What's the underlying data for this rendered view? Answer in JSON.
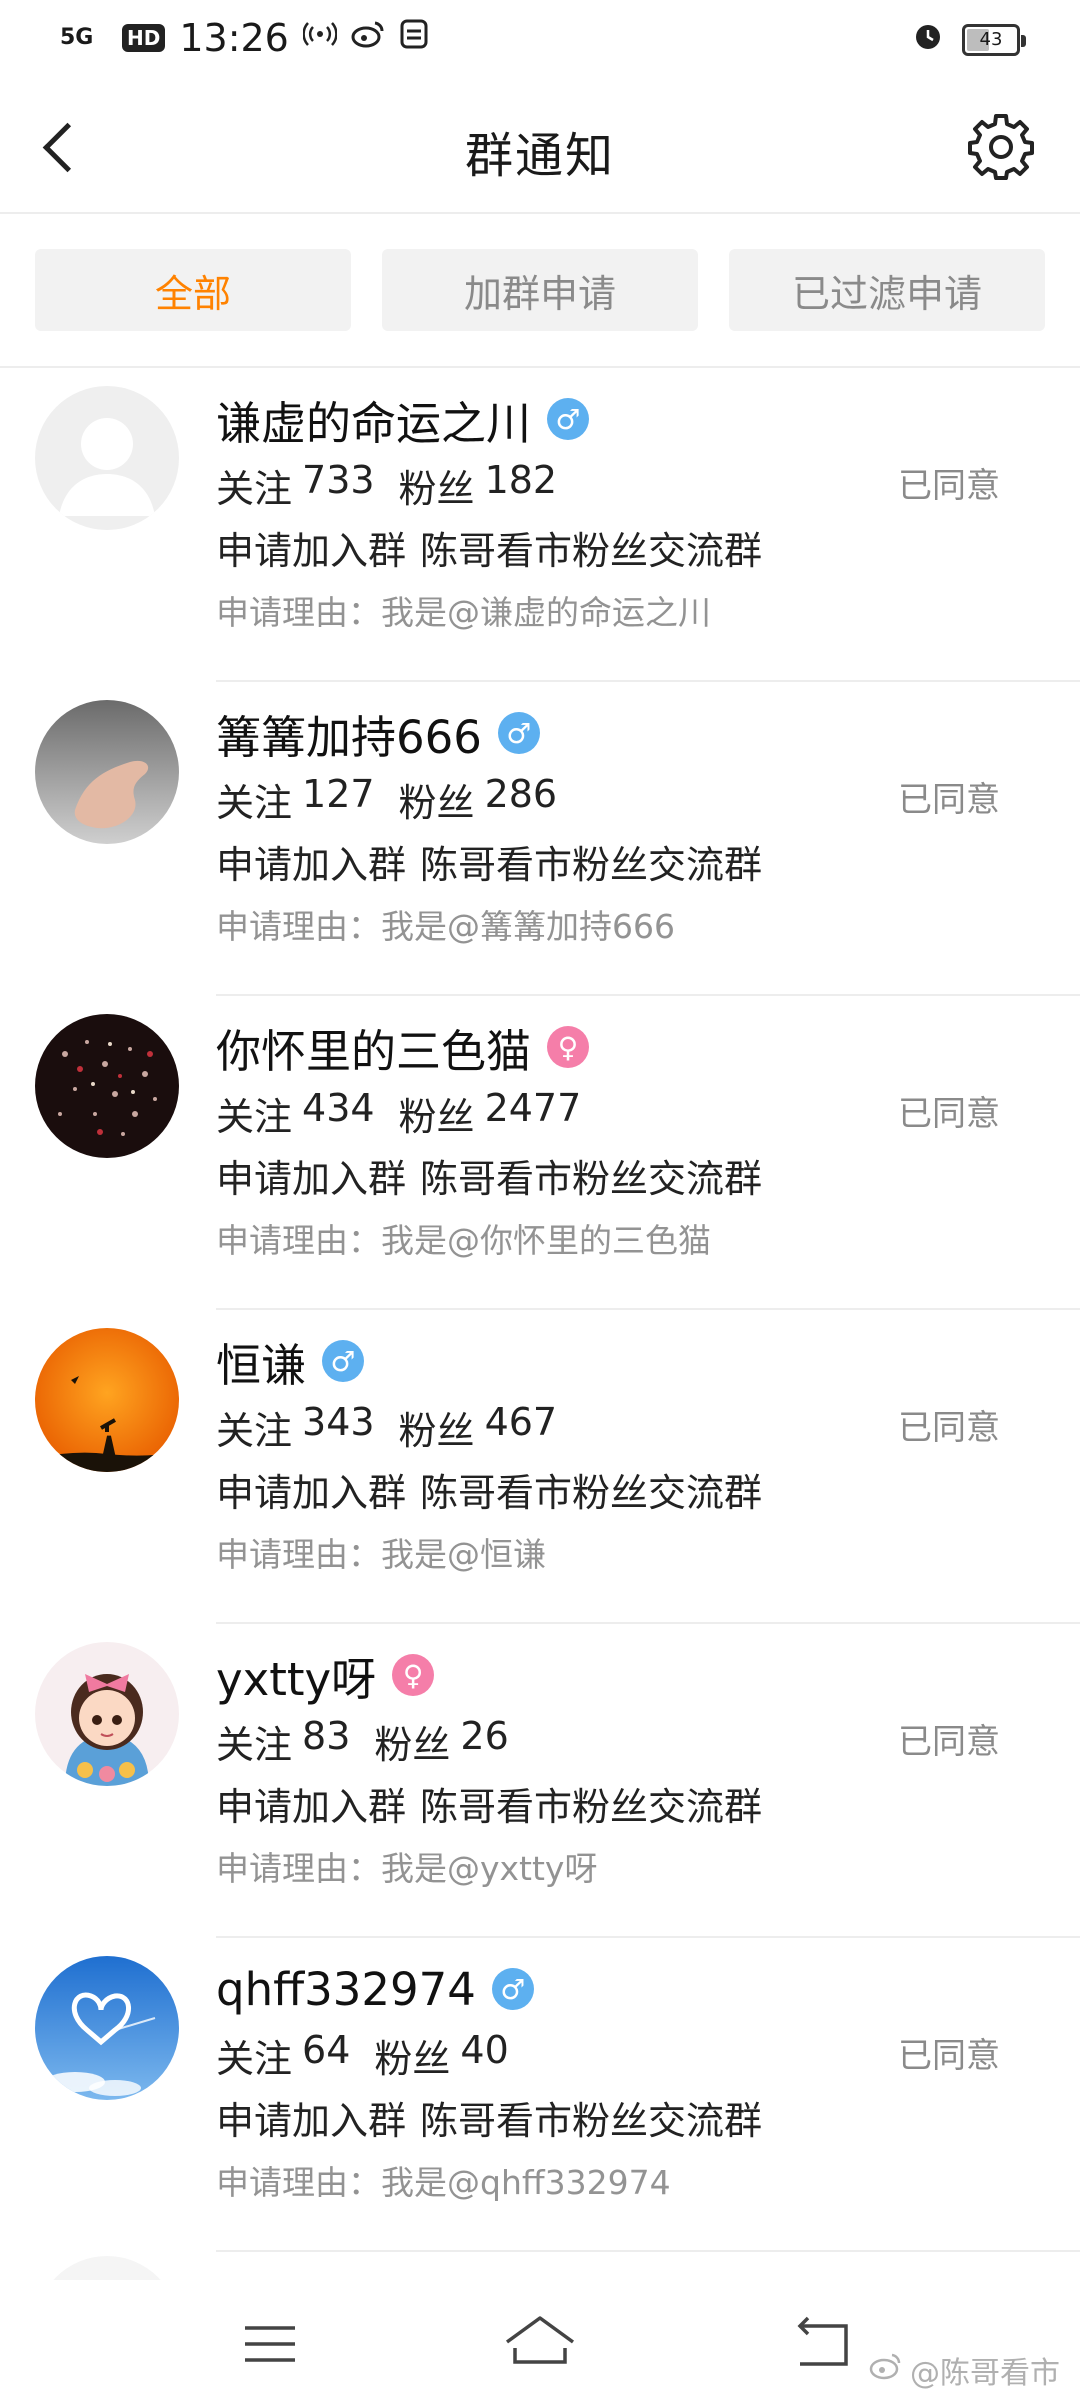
{
  "status_bar": {
    "network": "5G",
    "hd": "HD",
    "time": "13:26",
    "battery": "43",
    "battery_level": 0.43
  },
  "header": {
    "title": "群通知"
  },
  "tabs": [
    {
      "label": "全部",
      "active": true
    },
    {
      "label": "加群申请",
      "active": false
    },
    {
      "label": "已过滤申请",
      "active": false
    }
  ],
  "labels": {
    "follow": "关注",
    "fans": "粉丝",
    "apply_prefix": "申请加入群",
    "reason_prefix": "申请理由："
  },
  "requests": [
    {
      "name": "谦虚的命运之川",
      "gender": "male",
      "follow": "733",
      "fans": "182",
      "group": "陈哥看市粉丝交流群",
      "reason": "我是@谦虚的命运之川",
      "status": "已同意"
    },
    {
      "name": "篝篝加持666",
      "gender": "male",
      "follow": "127",
      "fans": "286",
      "group": "陈哥看市粉丝交流群",
      "reason": "我是@篝篝加持666",
      "status": "已同意"
    },
    {
      "name": "你怀里的三色猫",
      "gender": "female",
      "follow": "434",
      "fans": "2477",
      "group": "陈哥看市粉丝交流群",
      "reason": "我是@你怀里的三色猫",
      "status": "已同意"
    },
    {
      "name": "恒谦",
      "gender": "male",
      "follow": "343",
      "fans": "467",
      "group": "陈哥看市粉丝交流群",
      "reason": "我是@恒谦",
      "status": "已同意"
    },
    {
      "name": "yxtty呀",
      "gender": "female",
      "follow": "83",
      "fans": "26",
      "group": "陈哥看市粉丝交流群",
      "reason": "我是@yxtty呀",
      "status": "已同意"
    },
    {
      "name": "qhff332974",
      "gender": "male",
      "follow": "64",
      "fans": "40",
      "group": "陈哥看市粉丝交流群",
      "reason": "我是@qhff332974",
      "status": "已同意"
    }
  ],
  "watermark": "@陈哥看市",
  "colors": {
    "accent": "#ff8200",
    "male": "#5db0f0",
    "female": "#f57ea9",
    "muted": "#939393"
  }
}
